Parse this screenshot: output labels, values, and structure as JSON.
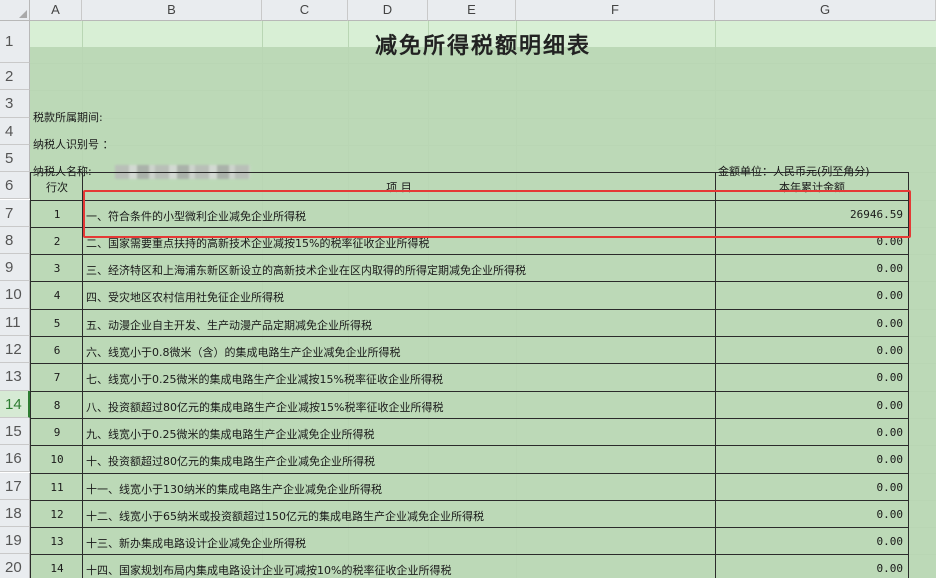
{
  "columns": [
    "A",
    "B",
    "C",
    "D",
    "E",
    "F",
    "G"
  ],
  "rows": [
    "1",
    "2",
    "3",
    "4",
    "5",
    "6",
    "7",
    "8",
    "9",
    "10",
    "11",
    "12",
    "13",
    "14",
    "15",
    "16",
    "17",
    "18",
    "19",
    "20"
  ],
  "active_row": "14",
  "title": "减免所得税额明细表",
  "period_label": "税款所属期间:",
  "taxpayer_id_label": "纳税人识别号 ：",
  "taxpayer_name_label": "纳税人名称:",
  "unit_label": "金额单位：人民币元(列至角分)",
  "header": {
    "seq": "行次",
    "item": "项          目",
    "amount": "本年累计金额"
  },
  "items": [
    {
      "seq": "1",
      "name": "一、符合条件的小型微利企业减免企业所得税",
      "amount": "26946.59"
    },
    {
      "seq": "2",
      "name": "二、国家需要重点扶持的高新技术企业减按15%的税率征收企业所得税",
      "amount": "0.00"
    },
    {
      "seq": "3",
      "name": "三、经济特区和上海浦东新区新设立的高新技术企业在区内取得的所得定期减免企业所得税",
      "amount": "0.00"
    },
    {
      "seq": "4",
      "name": "四、受灾地区农村信用社免征企业所得税",
      "amount": "0.00"
    },
    {
      "seq": "5",
      "name": "五、动漫企业自主开发、生产动漫产品定期减免企业所得税",
      "amount": "0.00"
    },
    {
      "seq": "6",
      "name": "六、线宽小于0.8微米（含）的集成电路生产企业减免企业所得税",
      "amount": "0.00"
    },
    {
      "seq": "7",
      "name": "七、线宽小于0.25微米的集成电路生产企业减按15%税率征收企业所得税",
      "amount": "0.00"
    },
    {
      "seq": "8",
      "name": "八、投资额超过80亿元的集成电路生产企业减按15%税率征收企业所得税",
      "amount": "0.00"
    },
    {
      "seq": "9",
      "name": "九、线宽小于0.25微米的集成电路生产企业减免企业所得税",
      "amount": "0.00"
    },
    {
      "seq": "10",
      "name": "十、投资额超过80亿元的集成电路生产企业减免企业所得税",
      "amount": "0.00"
    },
    {
      "seq": "11",
      "name": "十一、线宽小于130纳米的集成电路生产企业减免企业所得税",
      "amount": "0.00"
    },
    {
      "seq": "12",
      "name": "十二、线宽小于65纳米或投资额超过150亿元的集成电路生产企业减免企业所得税",
      "amount": "0.00"
    },
    {
      "seq": "13",
      "name": "十三、新办集成电路设计企业减免企业所得税",
      "amount": "0.00"
    },
    {
      "seq": "14",
      "name": "十四、国家规划布局内集成电路设计企业可减按10%的税率征收企业所得税",
      "amount": "0.00"
    }
  ],
  "colors": {
    "grid_bg": "#d8efd5",
    "highlight": "#e53935",
    "active_row": "#2e7d32"
  }
}
